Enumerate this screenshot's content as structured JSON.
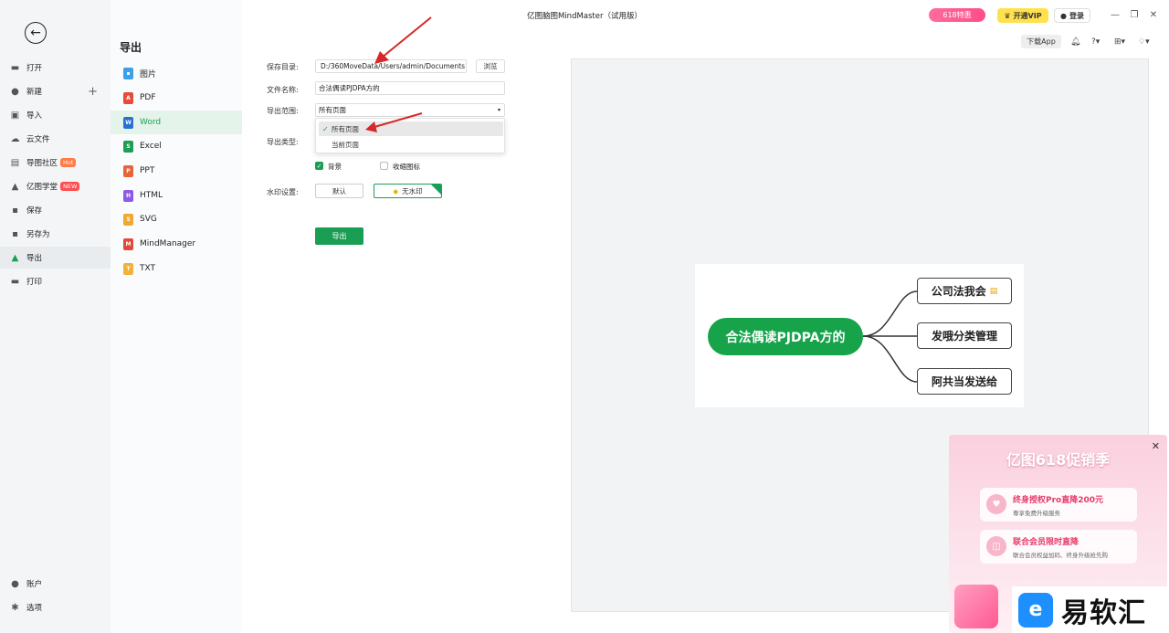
{
  "app": {
    "title": "亿图脑图MindMaster（试用版）"
  },
  "topbar": {
    "promo": "618特惠",
    "vip": "开通VIP",
    "login": "登录",
    "download_app": "下载App"
  },
  "sidebar": {
    "items": [
      {
        "label": "打开",
        "icon": "folder-icon"
      },
      {
        "label": "新建",
        "icon": "plus-circle-icon"
      },
      {
        "label": "导入",
        "icon": "import-icon"
      },
      {
        "label": "云文件",
        "icon": "cloud-icon"
      },
      {
        "label": "导图社区",
        "icon": "community-icon",
        "badge": "Hot"
      },
      {
        "label": "亿图学堂",
        "icon": "academy-icon",
        "badge": "NEW"
      },
      {
        "label": "保存",
        "icon": "save-icon"
      },
      {
        "label": "另存为",
        "icon": "save-as-icon"
      },
      {
        "label": "导出",
        "icon": "export-icon"
      },
      {
        "label": "打印",
        "icon": "print-icon"
      }
    ],
    "bottom": [
      {
        "label": "账户",
        "icon": "account-icon"
      },
      {
        "label": "选项",
        "icon": "settings-icon"
      }
    ]
  },
  "formats": {
    "title": "导出",
    "items": [
      {
        "label": "图片",
        "color": "#3aa0e8"
      },
      {
        "label": "PDF",
        "color": "#e84a3a"
      },
      {
        "label": "Word",
        "color": "#2b6fd6"
      },
      {
        "label": "Excel",
        "color": "#1f9d55"
      },
      {
        "label": "PPT",
        "color": "#e8643a"
      },
      {
        "label": "HTML",
        "color": "#8a5ce6"
      },
      {
        "label": "SVG",
        "color": "#f0a830"
      },
      {
        "label": "MindManager",
        "color": "#e04a3a"
      },
      {
        "label": "TXT",
        "color": "#f2b23a"
      }
    ]
  },
  "form": {
    "save_dir_label": "保存目录:",
    "save_dir_value": "D:/360MoveData/Users/admin/Documents",
    "browse": "浏览",
    "filename_label": "文件名称:",
    "filename_value": "合法偶读PJDPA方的",
    "range_label": "导出范围:",
    "range_value": "所有页面",
    "range_options": [
      "所有页面",
      "当前页面"
    ],
    "type_label": "导出类型:",
    "background_label": "背景",
    "collapse_label": "收缩图标",
    "watermark_label": "水印设置:",
    "watermark_default": "默认",
    "watermark_none": "无水印",
    "export_button": "导出"
  },
  "mindmap": {
    "central": "合法偶读PJDPA方的",
    "topics": [
      "公司法我会",
      "发哦分类管理",
      "阿共当发送给"
    ]
  },
  "promo_popup": {
    "title": "亿图618促销季",
    "offers": [
      {
        "title": "终身授权Pro直降200元",
        "sub": "尊享免费升级服务"
      },
      {
        "title": "联合会员限时直降",
        "sub": "联合会员权益加码、终身升级抢先购"
      }
    ]
  },
  "watermark": {
    "text": "易软汇"
  },
  "colors": {
    "accent": "#1a9e54",
    "central_topic": "#16a34a",
    "annotation_arrow": "#d62828"
  }
}
